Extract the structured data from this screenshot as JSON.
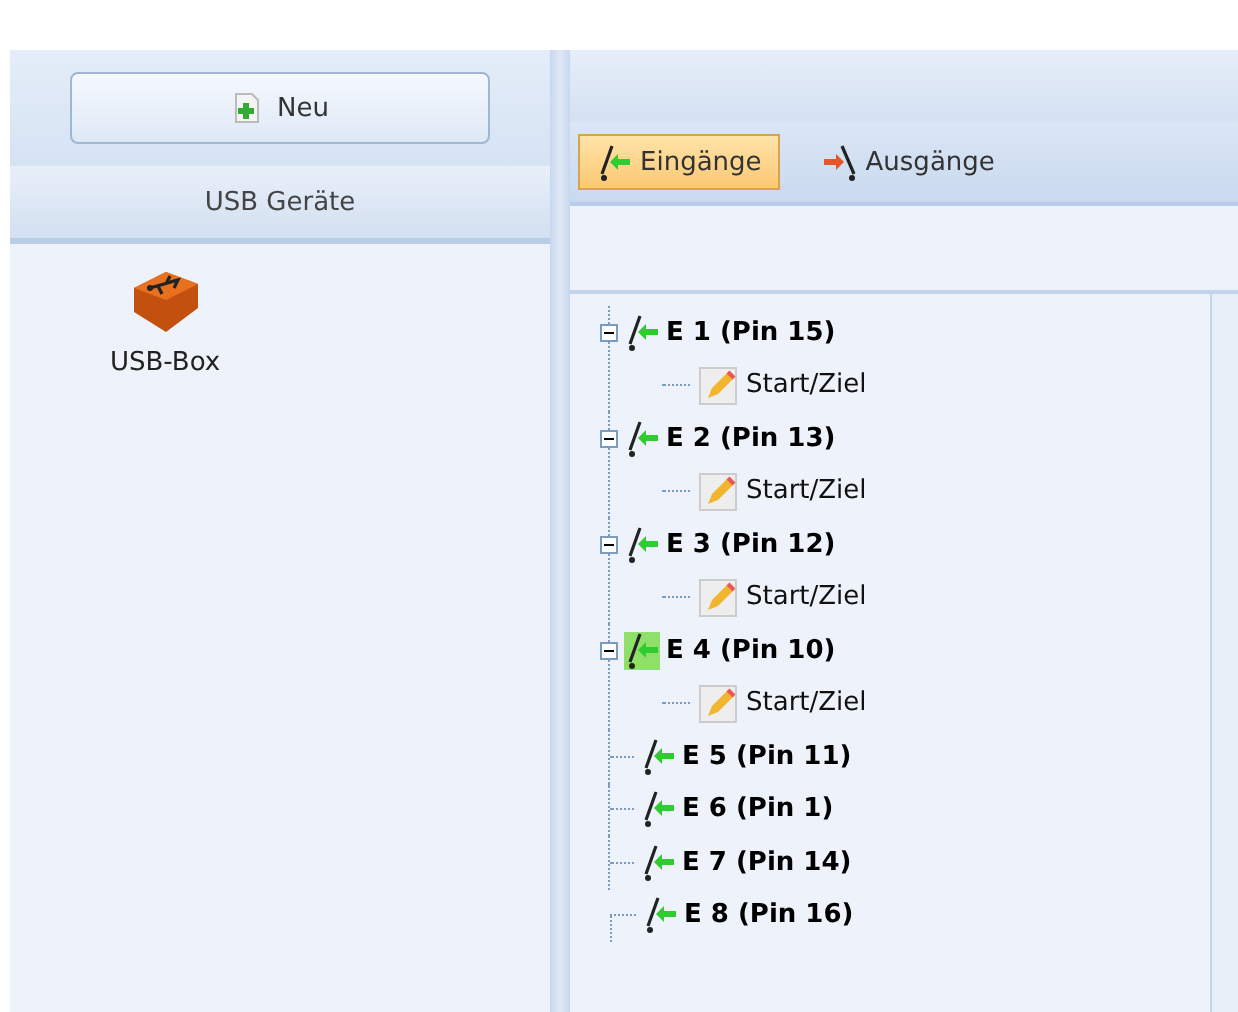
{
  "sidebar": {
    "new_button": "Neu",
    "header": "USB Geräte",
    "devices": [
      {
        "label": "USB-Box",
        "selected": false
      }
    ]
  },
  "toolbar": {
    "tabs": [
      {
        "label": "Eingänge",
        "kind": "input",
        "selected": true
      },
      {
        "label": "Ausgänge",
        "kind": "output",
        "selected": false
      }
    ]
  },
  "tree": [
    {
      "label": "E 1 (Pin 15)",
      "active": false,
      "expanded": true,
      "children": [
        {
          "label": "Start/Ziel"
        }
      ]
    },
    {
      "label": "E 2 (Pin 13)",
      "active": false,
      "expanded": true,
      "children": [
        {
          "label": "Start/Ziel"
        }
      ]
    },
    {
      "label": "E 3 (Pin 12)",
      "active": false,
      "expanded": true,
      "children": [
        {
          "label": "Start/Ziel"
        }
      ]
    },
    {
      "label": "E 4 (Pin 10)",
      "active": true,
      "expanded": true,
      "children": [
        {
          "label": "Start/Ziel"
        }
      ]
    },
    {
      "label": "E 5 (Pin 11)",
      "active": false
    },
    {
      "label": "E 6 (Pin 1)",
      "active": false
    },
    {
      "label": "E 7 (Pin 14)",
      "active": false
    },
    {
      "label": "E 8 (Pin 16)",
      "active": false
    }
  ]
}
